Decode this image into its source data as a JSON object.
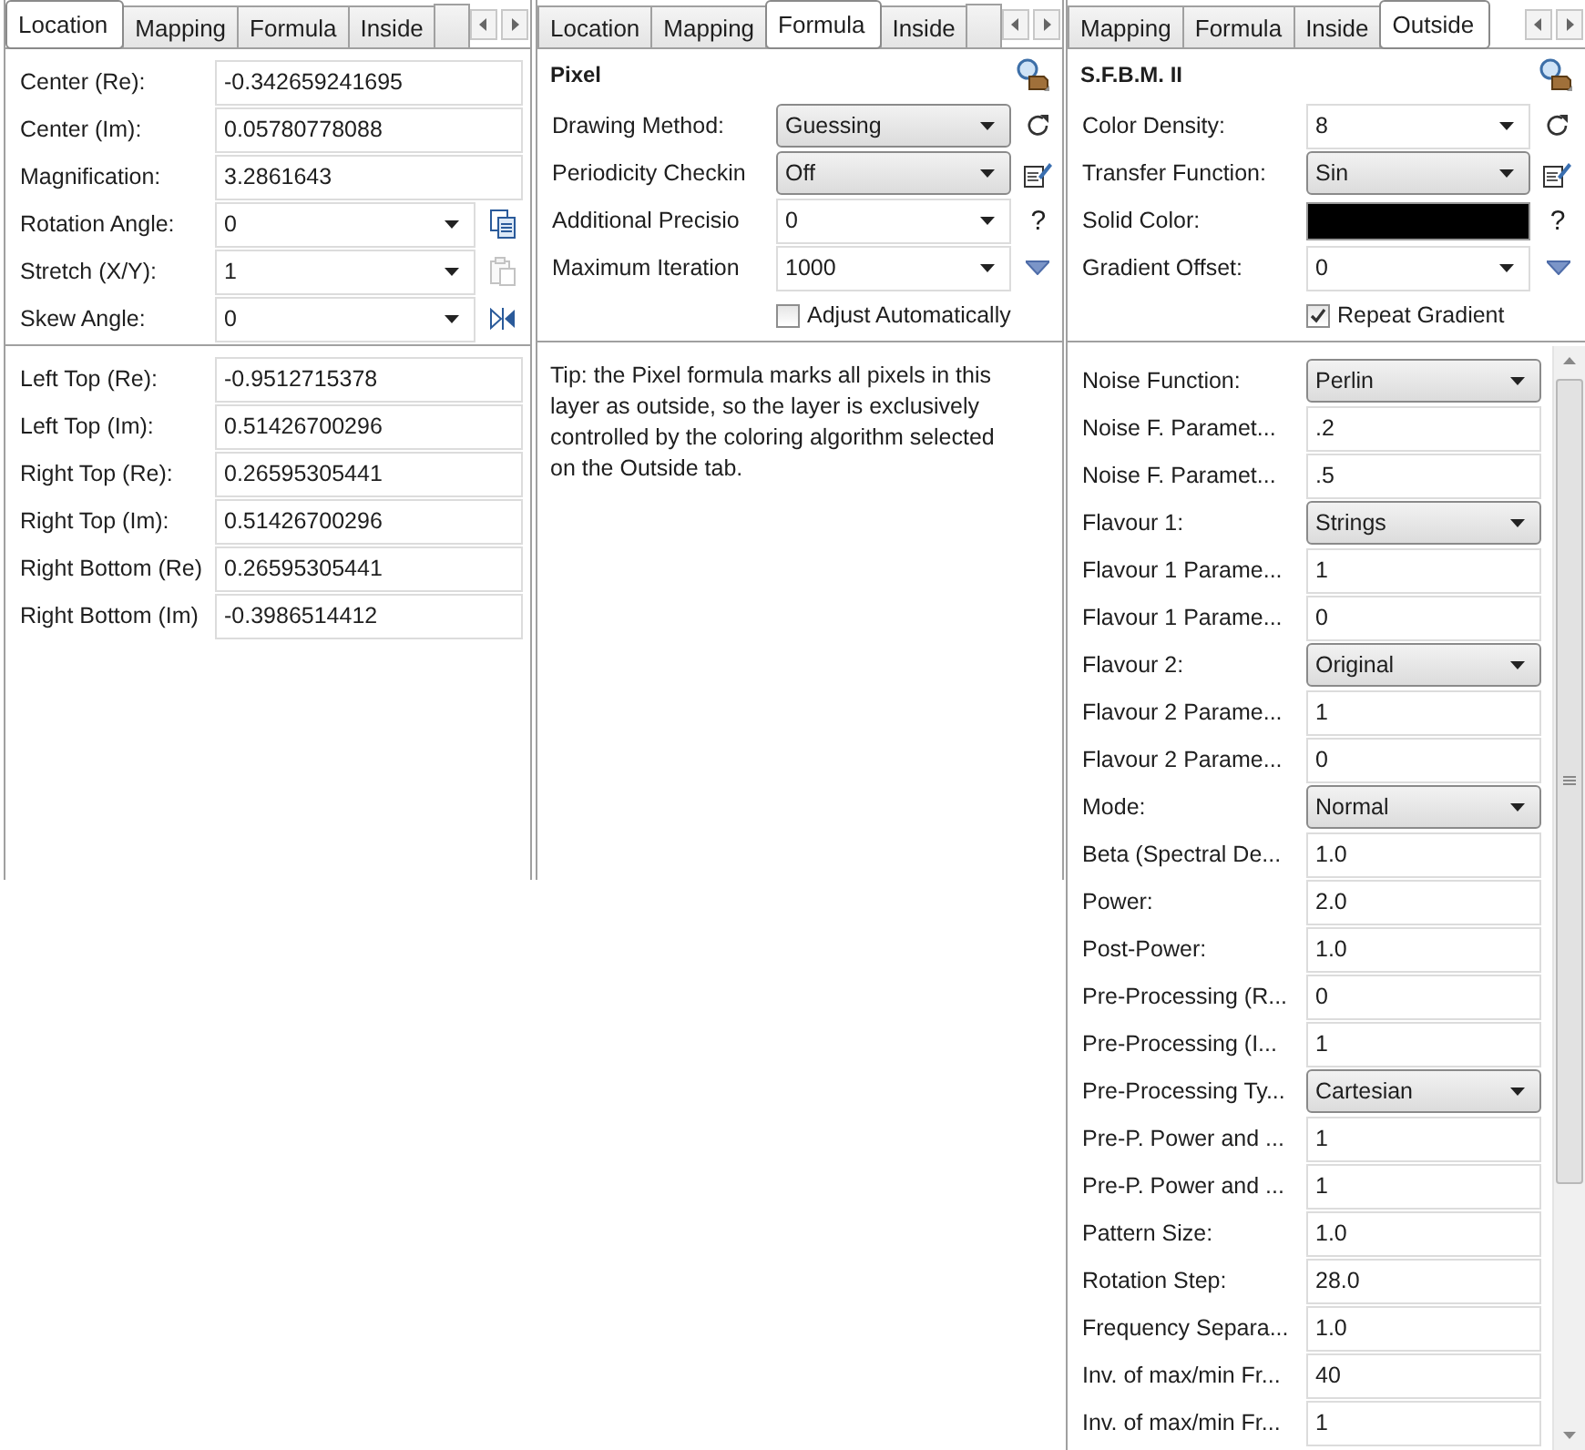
{
  "panels": [
    {
      "tabs": [
        {
          "label": "Location",
          "selected": true
        },
        {
          "label": "Mapping",
          "selected": false
        },
        {
          "label": "Formula",
          "selected": false
        },
        {
          "label": "Inside",
          "selected": false
        }
      ],
      "overflow_tab": true,
      "sections": [
        {
          "kind": "form",
          "rows": [
            {
              "kind": "text",
              "label": "Center (Re):",
              "value": "-0.342659241695"
            },
            {
              "kind": "text",
              "label": "Center (Im):",
              "value": "0.05780778088"
            },
            {
              "kind": "text",
              "label": "Magnification:",
              "value": "3.2861643"
            },
            {
              "kind": "combo",
              "label": "Rotation Angle:",
              "value": "0",
              "side": {
                "kind": "copy",
                "disabled": false
              }
            },
            {
              "kind": "combo",
              "label": "Stretch (X/Y):",
              "value": "1",
              "side": {
                "kind": "paste",
                "disabled": true
              }
            },
            {
              "kind": "combo",
              "label": "Skew Angle:",
              "value": "0",
              "side": {
                "kind": "flip",
                "disabled": false
              }
            }
          ]
        },
        {
          "kind": "form",
          "rows": [
            {
              "kind": "text",
              "label": "Left Top (Re):",
              "value": "-0.9512715378"
            },
            {
              "kind": "text",
              "label": "Left Top (Im):",
              "value": "0.51426700296"
            },
            {
              "kind": "text",
              "label": "Right Top (Re):",
              "value": "0.26595305441"
            },
            {
              "kind": "text",
              "label": "Right Top (Im):",
              "value": "0.51426700296"
            },
            {
              "kind": "text",
              "label": "Right Bottom (Re)",
              "value": "0.26595305441"
            },
            {
              "kind": "text",
              "label": "Right Bottom (Im)",
              "value": "-0.3986514412"
            }
          ]
        }
      ]
    },
    {
      "tabs": [
        {
          "label": "Location",
          "selected": false
        },
        {
          "label": "Mapping",
          "selected": false
        },
        {
          "label": "Formula",
          "selected": true
        },
        {
          "label": "Inside",
          "selected": false
        }
      ],
      "overflow_tab": true,
      "heading": "Pixel",
      "sections": [
        {
          "kind": "form",
          "rows": [
            {
              "kind": "select",
              "label": "Drawing Method:",
              "value": "Guessing",
              "side": {
                "kind": "refresh",
                "disabled": false
              }
            },
            {
              "kind": "select",
              "label": "Periodicity Checkin",
              "value": "Off",
              "side": {
                "kind": "edit",
                "disabled": false
              }
            },
            {
              "kind": "combo",
              "label": "Additional Precisio",
              "value": "0",
              "side": {
                "kind": "char",
                "text": "?"
              }
            },
            {
              "kind": "combo",
              "label": "Maximum Iteration",
              "value": "1000",
              "side": {
                "kind": "menu",
                "disabled": false
              }
            },
            {
              "kind": "check",
              "label": "Adjust Automatically",
              "checked": false
            }
          ]
        },
        {
          "kind": "tip",
          "text": "Tip: the Pixel formula marks all pixels in this layer as outside, so the layer is exclusively controlled by the coloring algorithm selected on the Outside tab."
        }
      ]
    },
    {
      "tabs": [
        {
          "label": "Mapping",
          "selected": false
        },
        {
          "label": "Formula",
          "selected": false
        },
        {
          "label": "Inside",
          "selected": false
        },
        {
          "label": "Outside",
          "selected": true
        }
      ],
      "overflow_tab": false,
      "heading": "S.F.B.M. II",
      "sections": [
        {
          "kind": "form",
          "rows": [
            {
              "kind": "combo",
              "label": "Color Density:",
              "value": "8",
              "side": {
                "kind": "refresh",
                "disabled": false
              }
            },
            {
              "kind": "select",
              "label": "Transfer Function:",
              "value": "Sin",
              "side": {
                "kind": "edit",
                "disabled": false
              }
            },
            {
              "kind": "color",
              "label": "Solid Color:",
              "color": "#000000",
              "side": {
                "kind": "char",
                "text": "?"
              }
            },
            {
              "kind": "combo",
              "label": "Gradient Offset:",
              "value": "0",
              "side": {
                "kind": "menu",
                "disabled": false
              }
            },
            {
              "kind": "check",
              "label": "Repeat Gradient",
              "checked": true
            }
          ]
        },
        {
          "kind": "scroll",
          "rows": [
            {
              "kind": "select",
              "label": "Noise Function:",
              "value": "Perlin"
            },
            {
              "kind": "text",
              "label": "Noise F. Paramet...",
              "value": ".2"
            },
            {
              "kind": "text",
              "label": "Noise F. Paramet...",
              "value": ".5"
            },
            {
              "kind": "select",
              "label": "Flavour 1:",
              "value": "Strings"
            },
            {
              "kind": "text",
              "label": "Flavour 1 Parame...",
              "value": "1"
            },
            {
              "kind": "text",
              "label": "Flavour 1 Parame...",
              "value": "0"
            },
            {
              "kind": "select",
              "label": "Flavour 2:",
              "value": "Original"
            },
            {
              "kind": "text",
              "label": "Flavour 2 Parame...",
              "value": "1"
            },
            {
              "kind": "text",
              "label": "Flavour 2 Parame...",
              "value": "0"
            },
            {
              "kind": "select",
              "label": "Mode:",
              "value": "Normal"
            },
            {
              "kind": "text",
              "label": "Beta (Spectral De...",
              "value": "1.0"
            },
            {
              "kind": "text",
              "label": "Power:",
              "value": "2.0"
            },
            {
              "kind": "text",
              "label": "Post-Power:",
              "value": "1.0"
            },
            {
              "kind": "text",
              "label": "Pre-Processing (R...",
              "value": "0"
            },
            {
              "kind": "text",
              "label": "Pre-Processing (I...",
              "value": "1"
            },
            {
              "kind": "select",
              "label": "Pre-Processing Ty...",
              "value": "Cartesian"
            },
            {
              "kind": "text",
              "label": "Pre-P. Power and ...",
              "value": "1"
            },
            {
              "kind": "text",
              "label": "Pre-P. Power and ...",
              "value": "1"
            },
            {
              "kind": "text",
              "label": "Pattern Size:",
              "value": "1.0"
            },
            {
              "kind": "text",
              "label": "Rotation Step:",
              "value": "28.0"
            },
            {
              "kind": "text",
              "label": "Frequency Separa...",
              "value": "1.0"
            },
            {
              "kind": "text",
              "label": "Inv. of max/min Fr...",
              "value": "40"
            },
            {
              "kind": "text",
              "label": "Inv. of max/min Fr...",
              "value": "1"
            }
          ]
        }
      ]
    }
  ]
}
